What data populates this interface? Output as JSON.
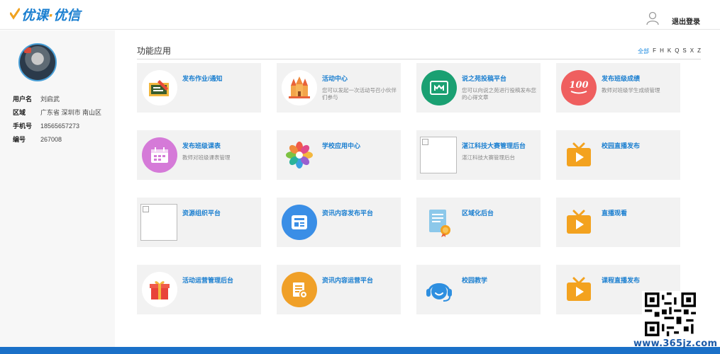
{
  "header": {
    "logo_text_a": "优课",
    "logo_dot": "·",
    "logo_text_b": "优信",
    "logout_label": "退出登录",
    "user_icon": "user-icon",
    "accent_color": "#1b7fd0"
  },
  "sidebar": {
    "avatar": "avatar",
    "fields": [
      {
        "key": "用户名",
        "value": "刘启武"
      },
      {
        "key": "区域",
        "value": "广东省 深圳市 南山区"
      },
      {
        "key": "手机号",
        "value": "18565657273"
      },
      {
        "key": "编号",
        "value": "267008"
      }
    ]
  },
  "main": {
    "section_title": "功能应用",
    "filters": [
      "全部",
      "F",
      "H",
      "K",
      "Q",
      "S",
      "X",
      "Z"
    ],
    "active_filter": "全部",
    "apps": [
      {
        "title": "发布作业/通知",
        "desc": "",
        "icon": "homework-icon"
      },
      {
        "title": "活动中心",
        "desc": "您可以发起一次活动号召小伙伴们参与",
        "icon": "castle-icon"
      },
      {
        "title": "说之苑投稿平台",
        "desc": "您可以向说之苑进行投稿发布您的心得文章",
        "icon": "submission-icon"
      },
      {
        "title": "发布班级成绩",
        "desc": "教师对班级学生成绩管理",
        "icon": "score-100-icon"
      },
      {
        "title": "发布班级课表",
        "desc": "教师对班级课表管理",
        "icon": "calendar-icon"
      },
      {
        "title": "学校应用中心",
        "desc": "",
        "icon": "flower-icon"
      },
      {
        "title": "湛江科技大赛管理后台",
        "desc": "湛江科技大赛管理后台",
        "icon": "broken-image-icon"
      },
      {
        "title": "校园直播发布",
        "desc": "",
        "icon": "tv-play-icon"
      },
      {
        "title": "资源组织平台",
        "desc": "",
        "icon": "broken-image-icon"
      },
      {
        "title": "资讯内容发布平台",
        "desc": "",
        "icon": "news-icon"
      },
      {
        "title": "区域化后台",
        "desc": "",
        "icon": "certificate-icon"
      },
      {
        "title": "直播观看",
        "desc": "",
        "icon": "tv-play-icon"
      },
      {
        "title": "活动运营管理后台",
        "desc": "",
        "icon": "gift-icon"
      },
      {
        "title": "资讯内容运营平台",
        "desc": "",
        "icon": "doc-gear-icon"
      },
      {
        "title": "校园教学",
        "desc": "",
        "icon": "headset-icon"
      },
      {
        "title": "课程直播发布",
        "desc": "",
        "icon": "tv-play-icon"
      }
    ]
  },
  "watermark": "www.365jz.com"
}
